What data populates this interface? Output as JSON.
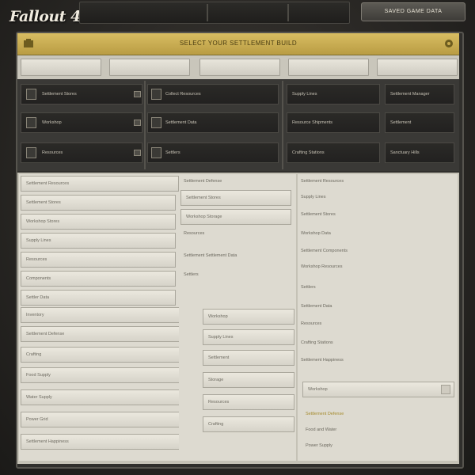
{
  "app": {
    "logo": "Fallout 4",
    "top_button": "SAVED GAME DATA"
  },
  "header": {
    "title": "SELECT YOUR SETTLEMENT BUILD"
  },
  "tabs": [
    "",
    "",
    "",
    "",
    ""
  ],
  "slots": [
    {
      "label": "Settlement Stores"
    },
    {
      "label": "Workshop"
    },
    {
      "label": "Resources"
    },
    {
      "label": "Collect Resources"
    },
    {
      "label": "Settlement Data"
    },
    {
      "label": "Settlers"
    },
    {
      "label": "Supply Lines"
    },
    {
      "label": "Resource Shipments"
    },
    {
      "label": "Crafting Stations"
    },
    {
      "label": "Settlement Manager"
    },
    {
      "label": "Settlement"
    },
    {
      "label": "Sanctuary Hills"
    }
  ],
  "list_left": [
    "Settlement Resources",
    "Settlement Stores",
    "Workshop Stores",
    "Supply Lines",
    "Resources",
    "Components",
    "Settler Data",
    "Inventory",
    "Settlement Defense",
    "Crafting",
    "Food Supply",
    "Water Supply",
    "Power Grid",
    "Settlement Happiness"
  ],
  "list_middle": [
    "Settlement Defense",
    "Settlement Stores",
    "Workshop Storage",
    "Resources",
    "Settlement Settlement Data",
    "Settlers",
    "Workshop",
    "Supply Lines",
    "Settlement",
    "Storage",
    "Resources",
    "Crafting"
  ],
  "list_right": [
    "Settlement Resources",
    "Supply Lines",
    "Settlement Stores",
    "Workshop Data",
    "Settlement Components",
    "Workshop Resources",
    "Settlers",
    "Settlement Data",
    "Resources",
    "Crafting Stations",
    "Settlement Happiness",
    "Workshop",
    "Settlement Defense",
    "Food and Water",
    "Power Supply"
  ],
  "colors": {
    "header": "#c9ab4f",
    "panel_dark": "#3a3936",
    "panel_light": "#dddad0",
    "accent_text": "#a58b2d"
  }
}
